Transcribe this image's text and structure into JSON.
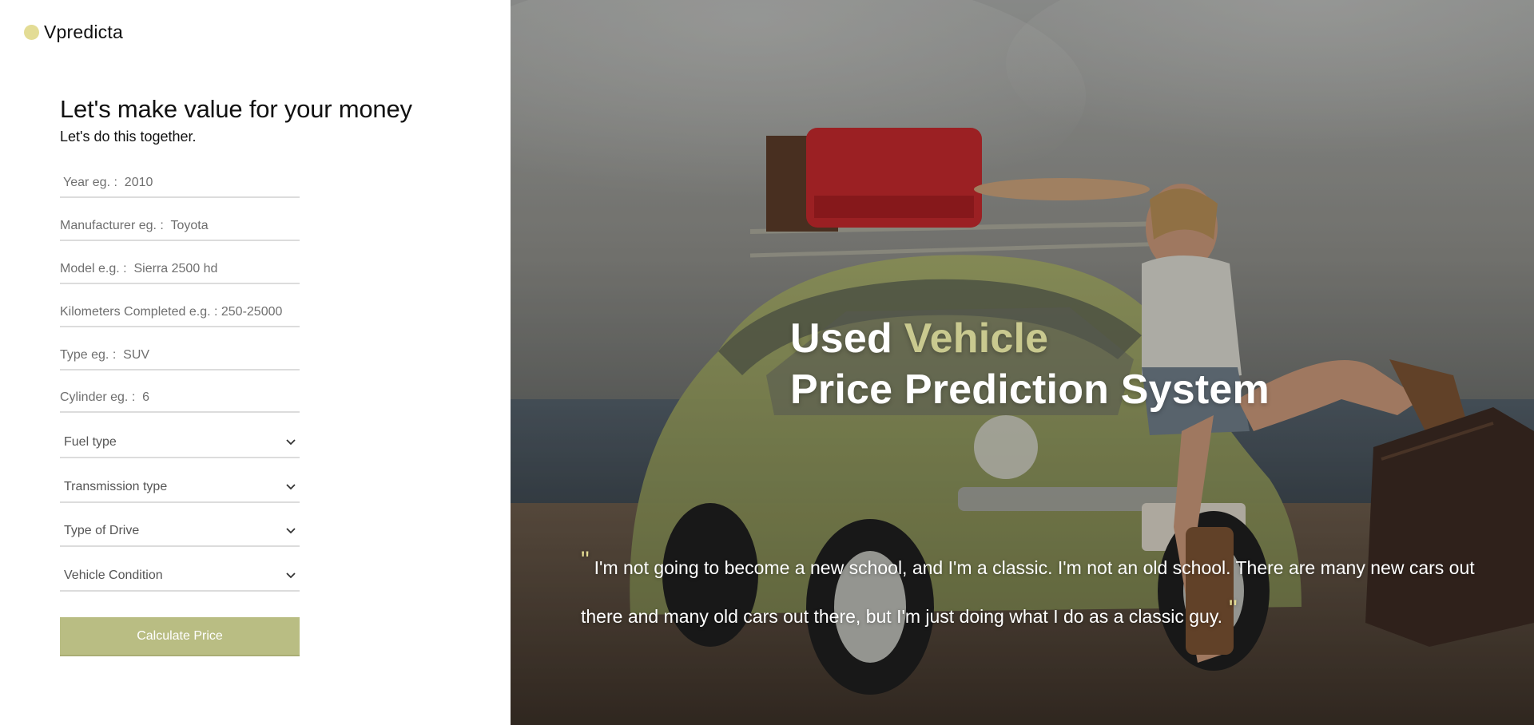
{
  "brand": {
    "name": "Vpredicta",
    "logo_color": "#e3dc95"
  },
  "form": {
    "heading": "Let's make value for your money",
    "subheading": "Let's do this together.",
    "fields": {
      "year": {
        "placeholder": "Year eg. :  2010"
      },
      "manufacturer": {
        "placeholder": "Manufacturer eg. :  Toyota"
      },
      "model": {
        "placeholder": "Model e.g. :  Sierra 2500 hd"
      },
      "kilometers": {
        "placeholder": "Kilometers Completed e.g. : 250-25000"
      },
      "type": {
        "placeholder": "Type eg. :  SUV"
      },
      "cylinder": {
        "placeholder": "Cylinder eg. :  6"
      }
    },
    "selects": {
      "fuel": {
        "label": "Fuel type"
      },
      "transmission": {
        "label": "Transmission type"
      },
      "drive": {
        "label": "Type of Drive"
      },
      "condition": {
        "label": "Vehicle Condition"
      }
    },
    "submit_label": "Calculate Price",
    "button_color": "#b9bd83"
  },
  "hero": {
    "title_part1": "Used ",
    "title_accent": "Vehicle",
    "title_line2": "Price Prediction System",
    "accent_color": "#c9c98f",
    "quote_open": "\"",
    "quote_text": "I'm not going to become a new school, and I'm a classic. I'm not an old school. There are many new cars out there and many old cars out there, but I'm just doing what I do as a classic guy.",
    "quote_close": "\"",
    "background_image": "beetle-car-beach-photo"
  }
}
